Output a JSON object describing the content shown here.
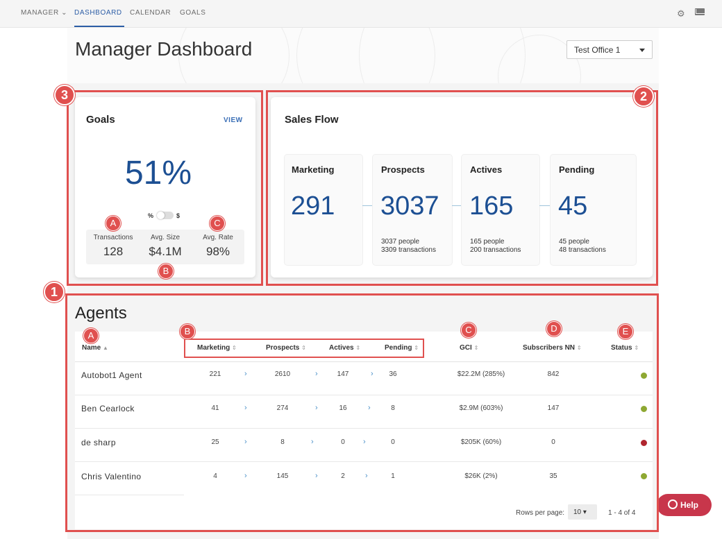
{
  "nav": {
    "items": [
      {
        "label": "MANAGER ⌄"
      },
      {
        "label": "DASHBOARD"
      },
      {
        "label": "CALENDAR"
      },
      {
        "label": "GOALS"
      }
    ],
    "active": "DASHBOARD",
    "icons": [
      "gear-icon",
      "mail-icon"
    ]
  },
  "header": {
    "title": "Manager Dashboard",
    "office_select": "Test Office 1"
  },
  "annotations": {
    "badges": [
      "1",
      "2",
      "3"
    ],
    "letters_goals": [
      "A",
      "B",
      "C"
    ],
    "letters_table": [
      "A",
      "B",
      "C",
      "D",
      "E"
    ],
    "frame_color": "#e0504f"
  },
  "goals": {
    "title": "Goals",
    "view_link": "VIEW",
    "percent": "51%",
    "toggle_left": "%",
    "toggle_right": "$",
    "stats": [
      {
        "label": "Transactions",
        "value": "128"
      },
      {
        "label": "Avg. Size",
        "value": "$4.1M"
      },
      {
        "label": "Avg. Rate",
        "value": "98%"
      }
    ]
  },
  "sales_flow": {
    "title": "Sales Flow",
    "stages": [
      {
        "label": "Marketing",
        "value": "291",
        "people": "",
        "transactions": ""
      },
      {
        "label": "Prospects",
        "value": "3037",
        "people": "3037 people",
        "transactions": "3309 transactions"
      },
      {
        "label": "Actives",
        "value": "165",
        "people": "165 people",
        "transactions": "200 transactions"
      },
      {
        "label": "Pending",
        "value": "45",
        "people": "45 people",
        "transactions": "48 transactions"
      }
    ]
  },
  "agents": {
    "title": "Agents",
    "columns": [
      "Name",
      "Marketing",
      "Prospects",
      "Actives",
      "Pending",
      "GCI",
      "Subscribers NN",
      "Status"
    ],
    "rows": [
      {
        "name": "Autobot1 Agent",
        "marketing": "221",
        "prospects": "2610",
        "actives": "147",
        "pending": "36",
        "gci": "$22.2M (285%)",
        "subscribers": "842",
        "status_color": "#8ea832"
      },
      {
        "name": "Ben Cearlock",
        "marketing": "41",
        "prospects": "274",
        "actives": "16",
        "pending": "8",
        "gci": "$2.9M (603%)",
        "subscribers": "147",
        "status_color": "#8ea832"
      },
      {
        "name": "de sharp",
        "marketing": "25",
        "prospects": "8",
        "actives": "0",
        "pending": "0",
        "gci": "$205K (60%)",
        "subscribers": "0",
        "status_color": "#b0262f"
      },
      {
        "name": "Chris Valentino",
        "marketing": "4",
        "prospects": "145",
        "actives": "2",
        "pending": "1",
        "gci": "$26K (2%)",
        "subscribers": "35",
        "status_color": "#8ea832"
      }
    ],
    "pager": {
      "rows_label": "Rows per page:",
      "rows_value": "10 ▾",
      "range": "1 - 4 of 4"
    }
  },
  "help": {
    "label": "Help"
  },
  "colors": {
    "accent_blue": "#1c4f93",
    "link_blue": "#3b6fb6",
    "help_red": "#c8364b"
  }
}
